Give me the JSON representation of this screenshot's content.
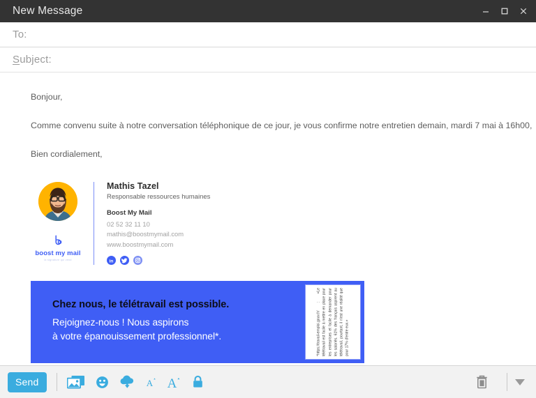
{
  "window": {
    "title": "New Message",
    "controls": [
      {
        "name": "minimize",
        "glyph": "minimize-icon"
      },
      {
        "name": "maximize",
        "glyph": "maximize-icon"
      },
      {
        "name": "close",
        "glyph": "close-icon"
      }
    ]
  },
  "header": {
    "to_label": "To:",
    "to_value": "",
    "to_placeholder": "To:",
    "subject_label_prefix": "S",
    "subject_label_rest": "ubject:",
    "subject_value": "",
    "subject_placeholder": "Subject:"
  },
  "message": {
    "greeting": "Bonjour,",
    "body": "Comme convenu suite à notre conversation téléphonique de ce jour, je vous confirme notre entretien demain, mardi 7 mai à 16h00,",
    "closing": "Bien cordialement,"
  },
  "signature": {
    "avatar_alt": "avatar-photo",
    "brand_name": "boost my mail",
    "brand_tagline": "la signature qui vend",
    "name": "Mathis Tazel",
    "role": "Responsable ressources humaines",
    "company": "Boost My Mail",
    "phone": "02 52 32 11 10",
    "email": "mathis@boostmymail.com",
    "website": "www.boostmymail.com",
    "social": [
      {
        "name": "linkedin-icon",
        "label": "in"
      },
      {
        "name": "twitter-icon",
        "label": "t"
      },
      {
        "name": "instagram-icon",
        "label": "ig"
      }
    ]
  },
  "banner": {
    "headline": "Chez nous, le télétravail est possible.",
    "line2": "Rejoignez-nous ! Nous aspirons",
    "line3": "à votre épanouissement professionnel*.",
    "footnote": "*https://travail-emploi.gouv.fr/ : «Le télétravail est facile à mettre en place pour les entreprises et facile à demander pour les salariés. 61% des français aspirent au télétravail, pourtant, il n'est une réalité que pour 17% d'entre eux.»",
    "bg_color": "#3F5EF5",
    "headline_color": "#0D0D18",
    "text_color": "#FFFFFF"
  },
  "toolbar": {
    "send_label": "Send",
    "send_color": "#3AACDF",
    "items": [
      {
        "name": "insert-image-icon",
        "title": "Insert image"
      },
      {
        "name": "emoji-icon",
        "title": "Insert emoji"
      },
      {
        "name": "cloud-download-icon",
        "title": "Attach from cloud"
      },
      {
        "name": "decrease-font-size-icon",
        "title": "Decrease font size",
        "label": "A"
      },
      {
        "name": "increase-font-size-icon",
        "title": "Increase font size",
        "label": "A"
      },
      {
        "name": "lock-icon",
        "title": "Encrypt"
      }
    ],
    "right_items": [
      {
        "name": "delete-draft-icon",
        "title": "Discard draft"
      },
      {
        "name": "more-options-icon",
        "title": "More options"
      }
    ]
  }
}
